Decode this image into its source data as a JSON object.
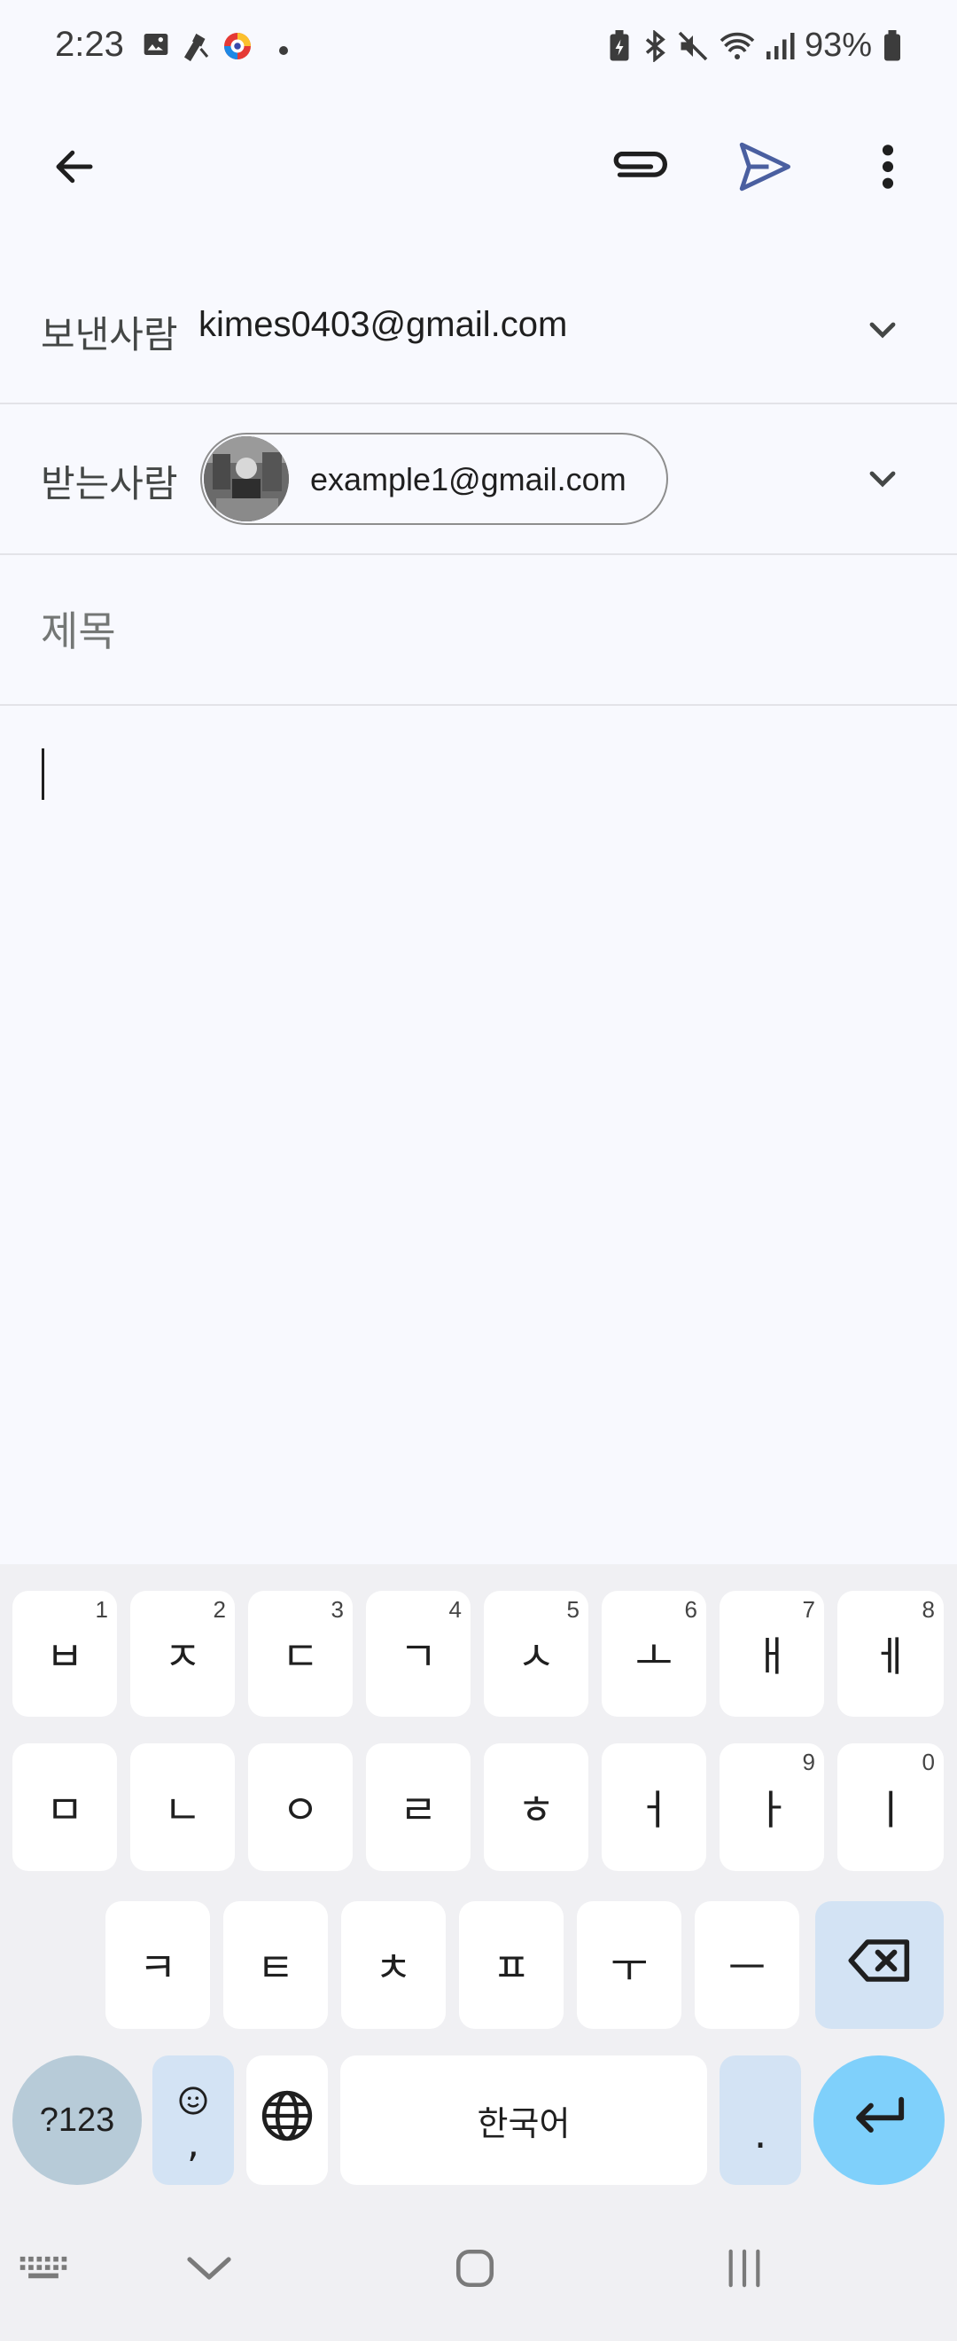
{
  "status_bar": {
    "time": "2:23",
    "battery": "93%",
    "left_icons": [
      "image-icon",
      "tool-icon",
      "app-icon",
      "dot-icon"
    ],
    "right_icons": [
      "battery-saver-icon",
      "bluetooth-icon",
      "mute-icon",
      "wifi-icon",
      "signal-icon",
      "battery-icon"
    ]
  },
  "toolbar": {
    "back_icon": "back-arrow-icon",
    "attach_icon": "attach-icon",
    "send_icon": "send-icon",
    "more_icon": "more-vert-icon"
  },
  "compose": {
    "from_label": "보낸사람",
    "from_value": "kimes0403@gmail.com",
    "to_label": "받는사람",
    "to_chip": "example1@gmail.com",
    "subject_placeholder": "제목",
    "body_value": ""
  },
  "keyboard": {
    "row1": [
      {
        "label": "ㅂ",
        "hint": "1"
      },
      {
        "label": "ㅈ",
        "hint": "2"
      },
      {
        "label": "ㄷ",
        "hint": "3"
      },
      {
        "label": "ㄱ",
        "hint": "4"
      },
      {
        "label": "ㅅ",
        "hint": "5"
      },
      {
        "label": "ㅗ",
        "hint": "6"
      },
      {
        "label": "ㅐ",
        "hint": "7"
      },
      {
        "label": "ㅔ",
        "hint": "8"
      }
    ],
    "row2": [
      {
        "label": "ㅁ",
        "hint": ""
      },
      {
        "label": "ㄴ",
        "hint": ""
      },
      {
        "label": "ㅇ",
        "hint": ""
      },
      {
        "label": "ㄹ",
        "hint": ""
      },
      {
        "label": "ㅎ",
        "hint": ""
      },
      {
        "label": "ㅓ",
        "hint": ""
      },
      {
        "label": "ㅏ",
        "hint": "9"
      },
      {
        "label": "ㅣ",
        "hint": "0"
      }
    ],
    "row3": [
      {
        "label": "ㅋ"
      },
      {
        "label": "ㅌ"
      },
      {
        "label": "ㅊ"
      },
      {
        "label": "ㅍ"
      },
      {
        "label": "ㅜ"
      },
      {
        "label": "ㅡ"
      }
    ],
    "symbols_label": "?123",
    "emoji_comma_label": ",",
    "space_label": "한국어",
    "period_label": ".",
    "colors": {
      "accent": "#7fd0fb",
      "symbols": "#b7cbd8",
      "aux": "#d3e3f4"
    }
  },
  "nav_bar": {
    "icons": [
      "keyboard-hide-icon",
      "chevron-down-icon",
      "home-icon",
      "recents-icon"
    ]
  }
}
